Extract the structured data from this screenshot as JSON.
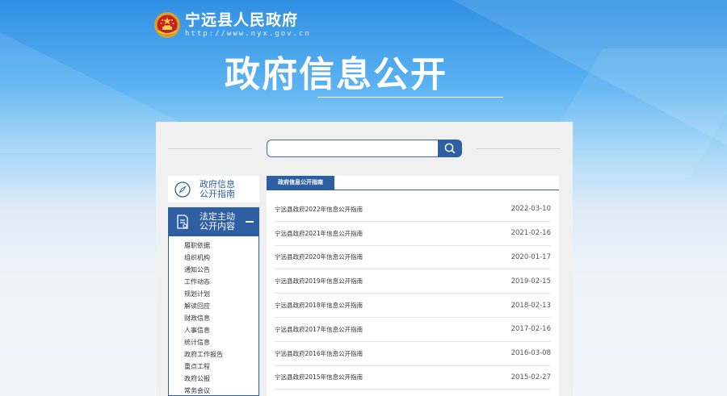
{
  "header": {
    "site_name": "宁远县人民政府",
    "site_url": "http://www.nyx.gov.cn",
    "hero_title": "政府信息公开"
  },
  "search": {
    "placeholder": "",
    "button_icon": "search-icon"
  },
  "sidebar": {
    "guide": {
      "line1": "政府信息",
      "line2": "公开指南",
      "icon": "compass-icon"
    },
    "active": {
      "line1": "法定主动",
      "line2": "公开内容",
      "icon": "document-icon"
    },
    "items": [
      "履职依据",
      "组织机构",
      "通知公告",
      "工作动态",
      "规划计划",
      "解读回应",
      "财政信息",
      "人事信息",
      "统计信息",
      "政府工作报告",
      "重点工程",
      "政府公报",
      "常务会议"
    ]
  },
  "content": {
    "tab_label": "政府信息公开指南",
    "rows": [
      {
        "title": "宁远县政府2022年信息公开指南",
        "date": "2022-03-10"
      },
      {
        "title": "宁远县政府2021年信息公开指南",
        "date": "2021-02-16"
      },
      {
        "title": "宁远县政府2020年信息公开指南",
        "date": "2020-01-17"
      },
      {
        "title": "宁远县政府2019年信息公开指南",
        "date": "2019-02-15"
      },
      {
        "title": "宁远县政府2018年信息公开指南",
        "date": "2018-02-13"
      },
      {
        "title": "宁远县政府2017年信息公开指南",
        "date": "2017-02-16"
      },
      {
        "title": "宁远县政府2016年信息公开指南",
        "date": "2016-03-08"
      },
      {
        "title": "宁远县政府2015年信息公开指南",
        "date": "2015-02-27"
      }
    ]
  },
  "colors": {
    "primary": "#2f5fa3",
    "sky": "#2f8fe3"
  }
}
